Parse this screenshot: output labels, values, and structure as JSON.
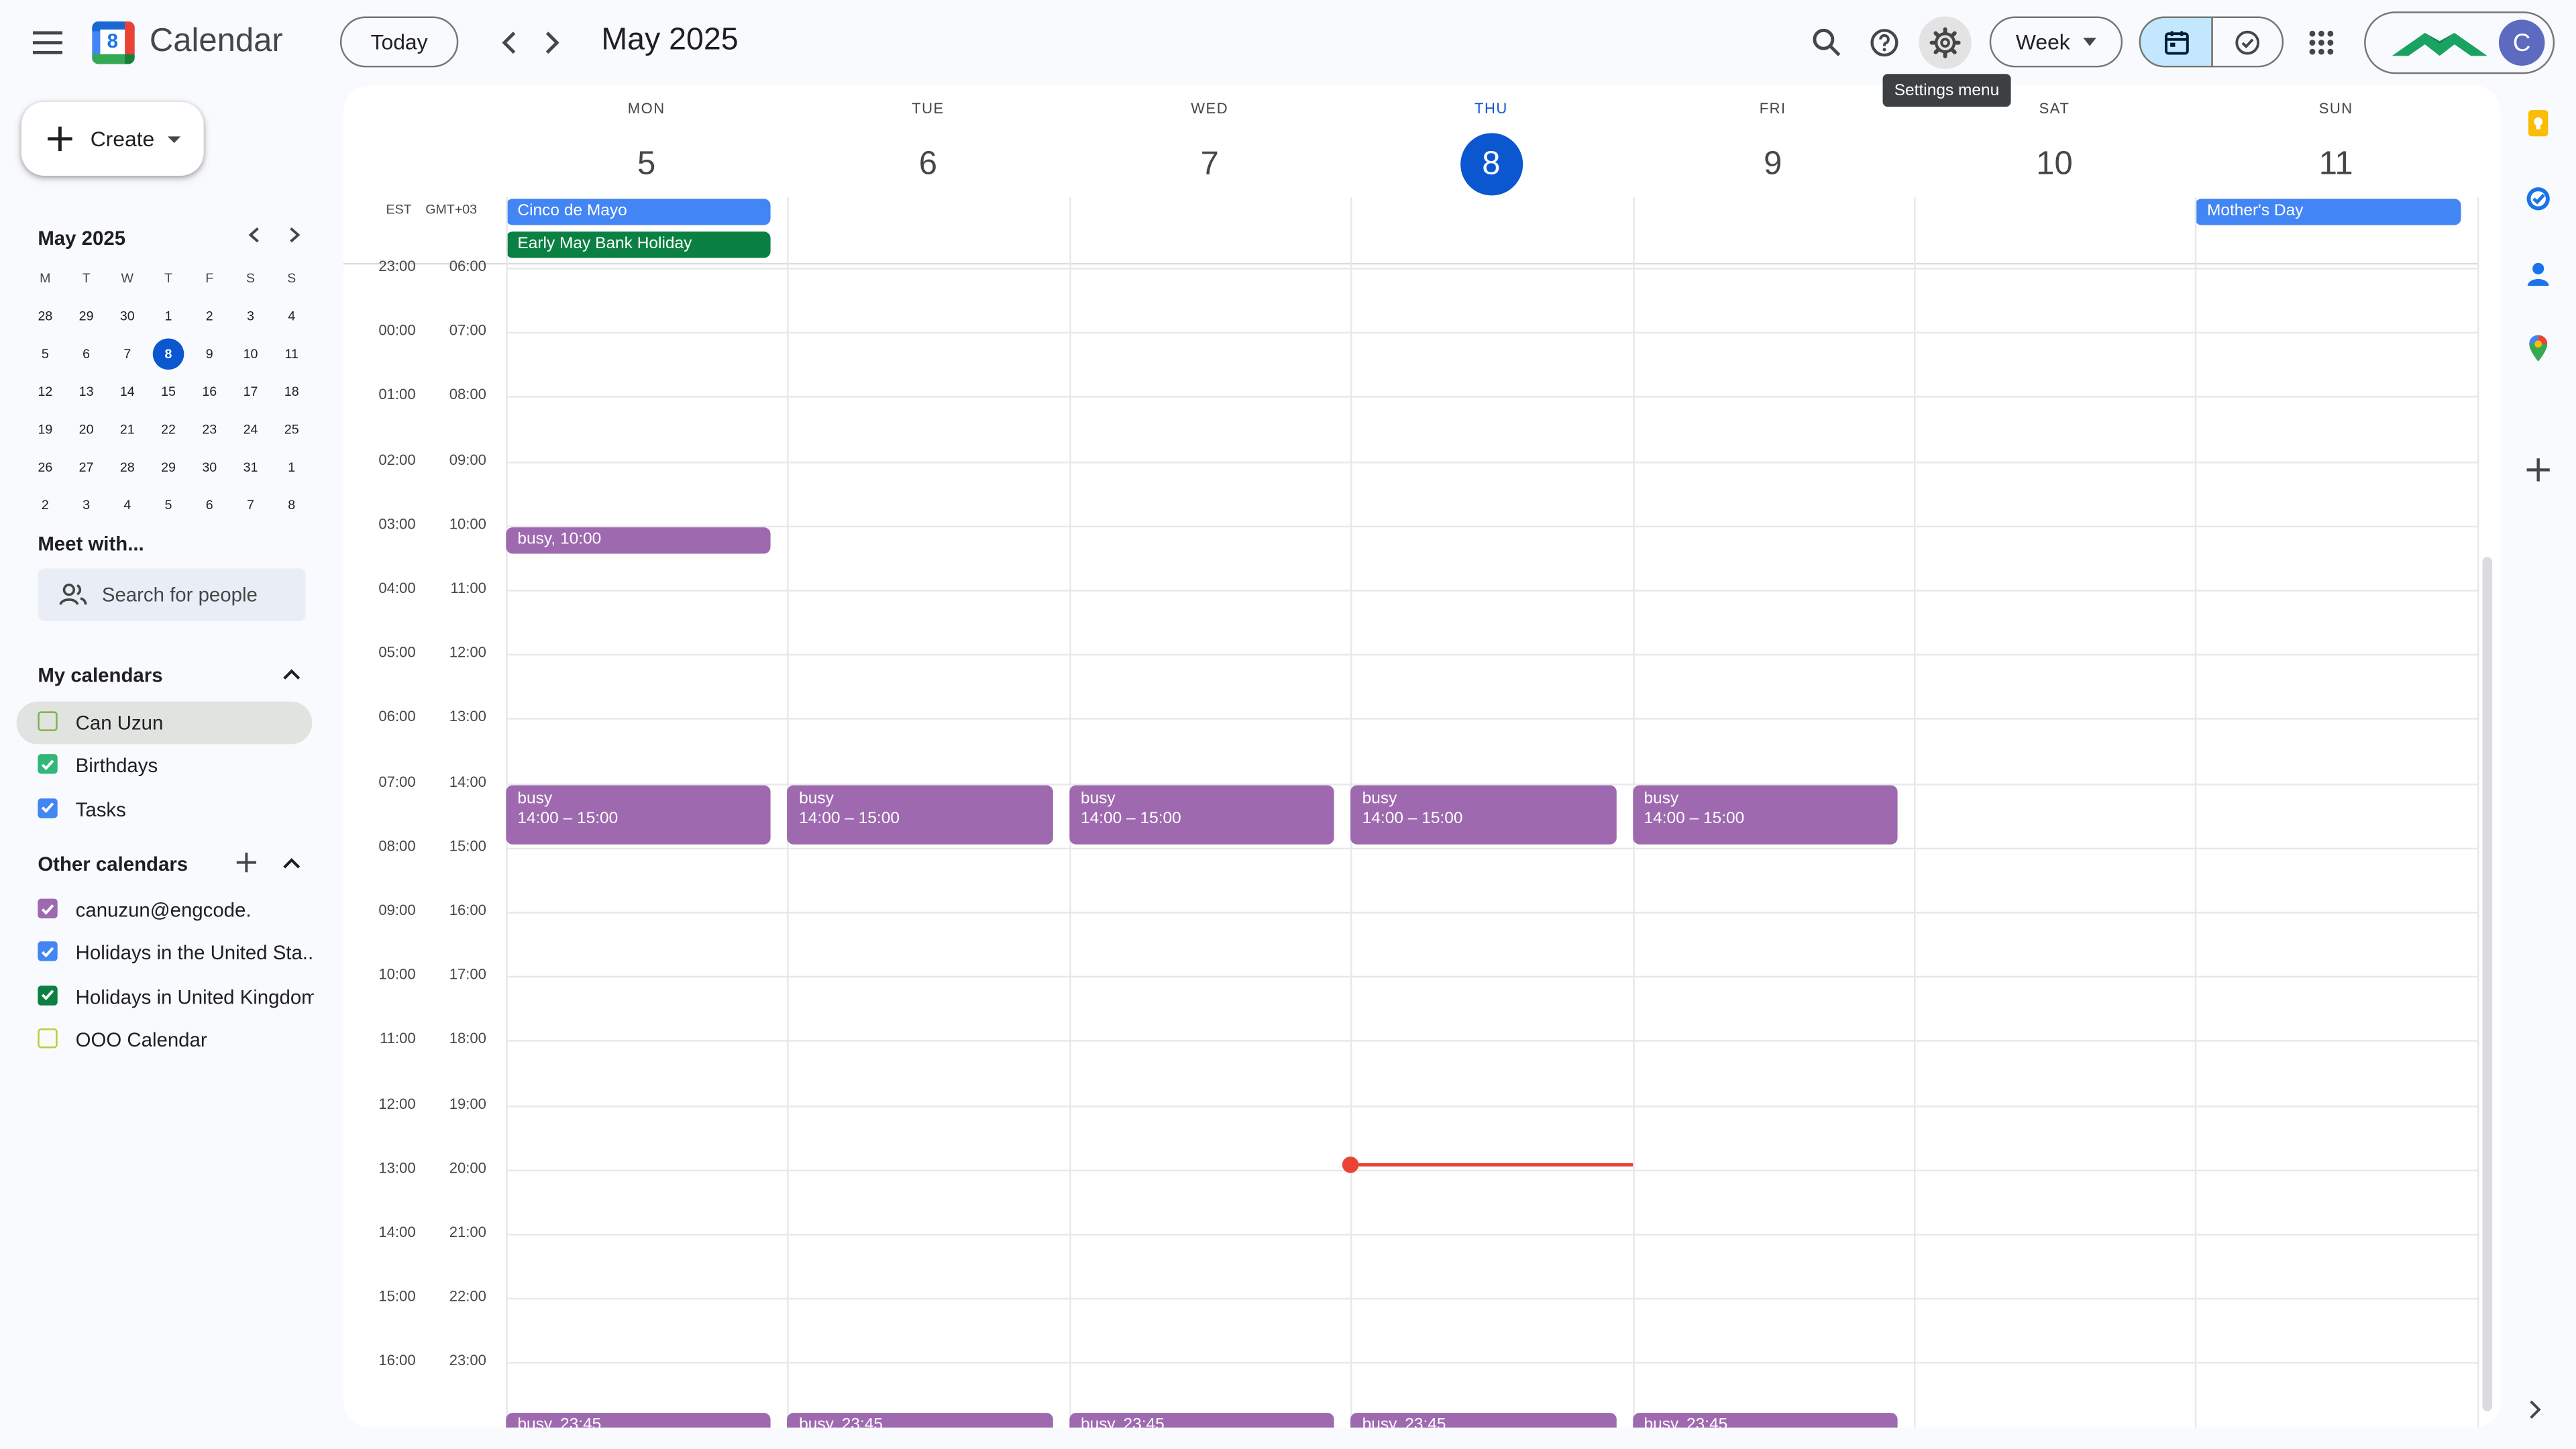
{
  "header": {
    "app_title": "Calendar",
    "logo_number": "8",
    "today_label": "Today",
    "period": "May 2025",
    "view_label": "Week",
    "avatar_letter": "C",
    "tooltip": "Settings menu"
  },
  "sidebar": {
    "create_label": "Create",
    "mini_cal": {
      "title": "May 2025",
      "weekdays": [
        "M",
        "T",
        "W",
        "T",
        "F",
        "S",
        "S"
      ],
      "weeks": [
        [
          "28",
          "29",
          "30",
          "1",
          "2",
          "3",
          "4"
        ],
        [
          "5",
          "6",
          "7",
          "8",
          "9",
          "10",
          "11"
        ],
        [
          "12",
          "13",
          "14",
          "15",
          "16",
          "17",
          "18"
        ],
        [
          "19",
          "20",
          "21",
          "22",
          "23",
          "24",
          "25"
        ],
        [
          "26",
          "27",
          "28",
          "29",
          "30",
          "31",
          "1"
        ],
        [
          "2",
          "3",
          "4",
          "5",
          "6",
          "7",
          "8"
        ]
      ],
      "selected_day": "8"
    },
    "meet_with_title": "Meet with...",
    "search_people_placeholder": "Search for people",
    "my_calendars_title": "My calendars",
    "my_calendars": [
      {
        "name": "Can Uzun",
        "checked": false,
        "color": "#7cb342"
      },
      {
        "name": "Birthdays",
        "checked": true,
        "color": "#33b679"
      },
      {
        "name": "Tasks",
        "checked": true,
        "color": "#4285f4"
      }
    ],
    "other_calendars_title": "Other calendars",
    "other_calendars": [
      {
        "name": "canuzun@engcode.",
        "checked": true,
        "color": "#9e69af"
      },
      {
        "name": "Holidays in the United Sta...",
        "checked": true,
        "color": "#4285f4"
      },
      {
        "name": "Holidays in United Kingdom",
        "checked": true,
        "color": "#0b8043"
      },
      {
        "name": "OOO Calendar",
        "checked": false,
        "color": "#c0ca33"
      }
    ]
  },
  "week": {
    "timezones": [
      "EST",
      "GMT+03"
    ],
    "days": [
      {
        "dow": "MON",
        "num": "5",
        "today": false
      },
      {
        "dow": "TUE",
        "num": "6",
        "today": false
      },
      {
        "dow": "WED",
        "num": "7",
        "today": false
      },
      {
        "dow": "THU",
        "num": "8",
        "today": true
      },
      {
        "dow": "FRI",
        "num": "9",
        "today": false
      },
      {
        "dow": "SAT",
        "num": "10",
        "today": false
      },
      {
        "dow": "SUN",
        "num": "11",
        "today": false
      }
    ],
    "allday_events": [
      {
        "title": "Cinco de Mayo",
        "day": 0,
        "slot": 0,
        "color": "#4285f4"
      },
      {
        "title": "Early May Bank Holiday",
        "day": 0,
        "slot": 1,
        "color": "#0b8043"
      },
      {
        "title": "Mother's Day",
        "day": 6,
        "slot": 0,
        "color": "#4285f4"
      }
    ],
    "time_rows": [
      {
        "est": "23:00",
        "gmt3": "06:00"
      },
      {
        "est": "00:00",
        "gmt3": "07:00"
      },
      {
        "est": "01:00",
        "gmt3": "08:00"
      },
      {
        "est": "02:00",
        "gmt3": "09:00"
      },
      {
        "est": "03:00",
        "gmt3": "10:00"
      },
      {
        "est": "04:00",
        "gmt3": "11:00"
      },
      {
        "est": "05:00",
        "gmt3": "12:00"
      },
      {
        "est": "06:00",
        "gmt3": "13:00"
      },
      {
        "est": "07:00",
        "gmt3": "14:00"
      },
      {
        "est": "08:00",
        "gmt3": "15:00"
      },
      {
        "est": "09:00",
        "gmt3": "16:00"
      },
      {
        "est": "10:00",
        "gmt3": "17:00"
      },
      {
        "est": "11:00",
        "gmt3": "18:00"
      },
      {
        "est": "12:00",
        "gmt3": "19:00"
      },
      {
        "est": "13:00",
        "gmt3": "20:00"
      },
      {
        "est": "14:00",
        "gmt3": "21:00"
      },
      {
        "est": "15:00",
        "gmt3": "22:00"
      },
      {
        "est": "16:00",
        "gmt3": "23:00"
      }
    ],
    "events": [
      {
        "day": 0,
        "title": "busy",
        "time": "10:00",
        "start_hour": 10.0,
        "end_hour": 10.5,
        "inline": true
      },
      {
        "day": 0,
        "title": "busy",
        "time": "14:00 – 15:00",
        "start_hour": 14.0,
        "end_hour": 15.0,
        "inline": false
      },
      {
        "day": 1,
        "title": "busy",
        "time": "14:00 – 15:00",
        "start_hour": 14.0,
        "end_hour": 15.0,
        "inline": false
      },
      {
        "day": 2,
        "title": "busy",
        "time": "14:00 – 15:00",
        "start_hour": 14.0,
        "end_hour": 15.0,
        "inline": false
      },
      {
        "day": 3,
        "title": "busy",
        "time": "14:00 – 15:00",
        "start_hour": 14.0,
        "end_hour": 15.0,
        "inline": false
      },
      {
        "day": 4,
        "title": "busy",
        "time": "14:00 – 15:00",
        "start_hour": 14.0,
        "end_hour": 15.0,
        "inline": false
      },
      {
        "day": 0,
        "title": "busy",
        "time": "23:45",
        "start_hour": 23.75,
        "end_hour": 24.25,
        "inline": true
      },
      {
        "day": 1,
        "title": "busy",
        "time": "23:45",
        "start_hour": 23.75,
        "end_hour": 24.25,
        "inline": true
      },
      {
        "day": 2,
        "title": "busy",
        "time": "23:45",
        "start_hour": 23.75,
        "end_hour": 24.25,
        "inline": true
      },
      {
        "day": 3,
        "title": "busy",
        "time": "23:45",
        "start_hour": 23.75,
        "end_hour": 24.25,
        "inline": true
      },
      {
        "day": 4,
        "title": "busy",
        "time": "23:45",
        "start_hour": 23.75,
        "end_hour": 24.25,
        "inline": true
      }
    ],
    "now": {
      "day": 3,
      "hour": 20.0
    }
  },
  "colors": {
    "accent": "#0b57d0",
    "event": "#9e69af",
    "now": "#ea4335"
  },
  "icons": [
    "menu-icon",
    "chevron-left-icon",
    "chevron-right-icon",
    "search-icon",
    "help-icon",
    "gear-icon",
    "caret-down-icon",
    "calendar-icon",
    "task-check-icon",
    "apps-grid-icon",
    "people-icon",
    "keep-icon",
    "tasks-icon",
    "contacts-icon",
    "maps-icon",
    "plus-icon"
  ]
}
